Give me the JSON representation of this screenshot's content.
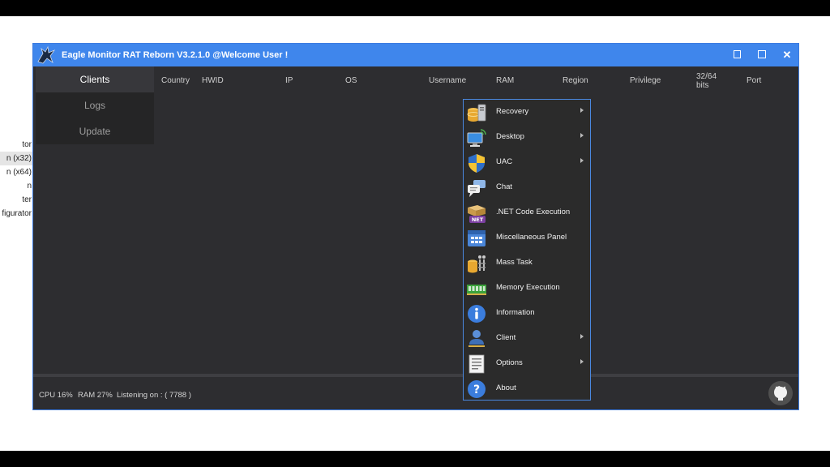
{
  "window": {
    "title": "Eagle Monitor RAT Reborn V3.2.1.0 @Welcome User !"
  },
  "background_list": [
    "tor",
    "n (x32)",
    "n (x64)",
    "n",
    "ter",
    "figurator"
  ],
  "sidebar": {
    "items": [
      {
        "label": "Clients"
      },
      {
        "label": "Logs"
      },
      {
        "label": "Update"
      }
    ]
  },
  "columns": {
    "country": "Country",
    "hwid": "HWID",
    "ip": "IP",
    "os": "OS",
    "username": "Username",
    "ram": "RAM",
    "region": "Region",
    "privilege": "Privilege",
    "bits": "32/64 bits",
    "port": "Port"
  },
  "status": {
    "cpu": "CPU 16%",
    "ram": "RAM 27%",
    "listening": "Listening on : ( 7788 )"
  },
  "context_menu": {
    "items": [
      {
        "label": "Recovery",
        "submenu": true,
        "icon": "database-server-icon"
      },
      {
        "label": "Desktop",
        "submenu": true,
        "icon": "remote-desktop-icon"
      },
      {
        "label": "UAC",
        "submenu": true,
        "icon": "uac-shield-icon"
      },
      {
        "label": "Chat",
        "submenu": false,
        "icon": "chat-bubbles-icon"
      },
      {
        "label": ".NET Code Execution",
        "submenu": false,
        "icon": "dotnet-icon"
      },
      {
        "label": "Miscellaneous Panel",
        "submenu": false,
        "icon": "panel-window-icon"
      },
      {
        "label": "Mass Task",
        "submenu": false,
        "icon": "mass-task-icon"
      },
      {
        "label": "Memory Execution",
        "submenu": false,
        "icon": "memory-chip-icon"
      },
      {
        "label": "Information",
        "submenu": false,
        "icon": "info-icon"
      },
      {
        "label": "Client",
        "submenu": true,
        "icon": "client-user-icon"
      },
      {
        "label": "Options",
        "submenu": true,
        "icon": "options-document-icon"
      },
      {
        "label": "About",
        "submenu": false,
        "icon": "about-question-icon"
      }
    ]
  },
  "colors": {
    "titlebar": "#3f86ec",
    "window_bg": "#2d2d30",
    "menu_border": "#4a88e0"
  }
}
